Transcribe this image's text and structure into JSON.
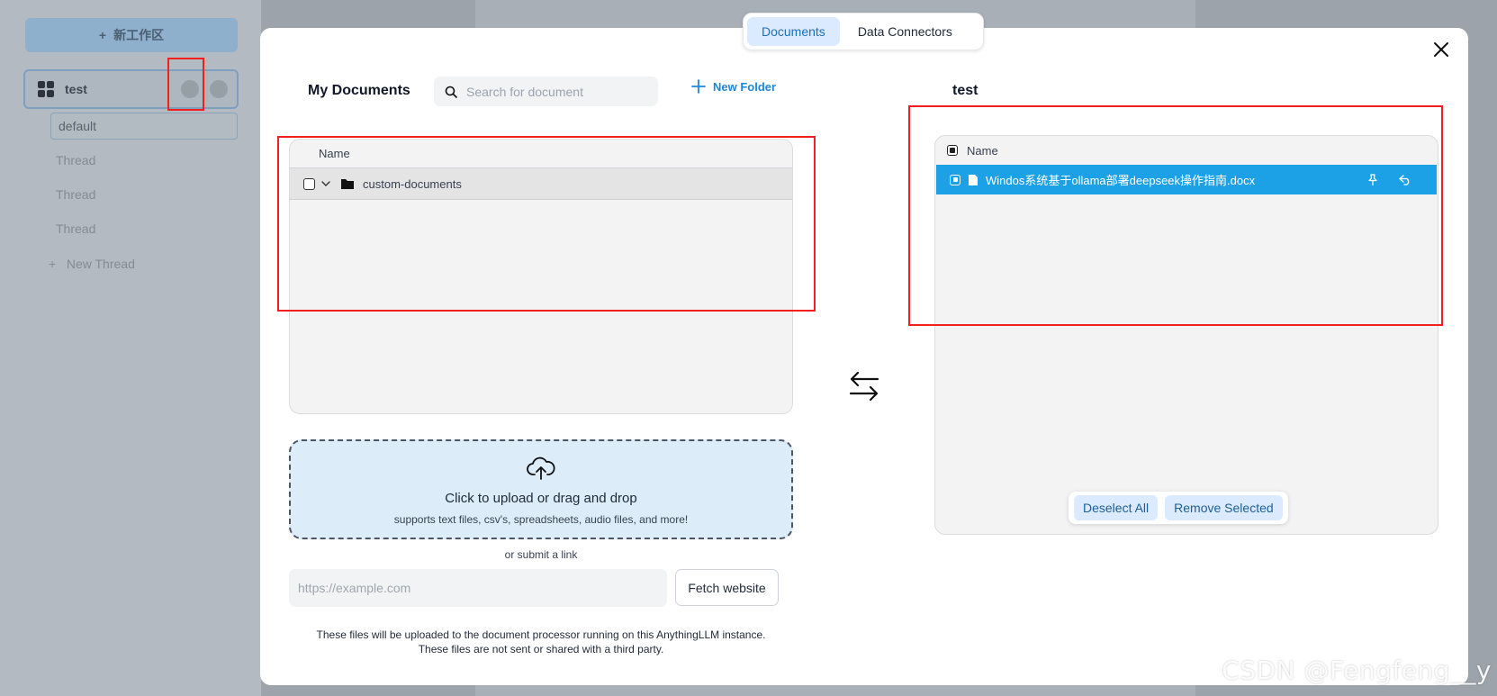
{
  "background": {
    "new_workspace_label": "新工作区",
    "workspace_name": "test",
    "threads": [
      "default",
      "Thread",
      "Thread",
      "Thread"
    ],
    "new_thread_label": "New Thread"
  },
  "modal": {
    "tabs": [
      {
        "label": "Documents",
        "active": true
      },
      {
        "label": "Data Connectors",
        "active": false
      }
    ],
    "left": {
      "title": "My Documents",
      "search_placeholder": "Search for document",
      "new_folder_label": "New Folder",
      "column_name": "Name",
      "folder_name": "custom-documents"
    },
    "upload": {
      "title": "Click to upload or drag and drop",
      "subtitle": "supports text files, csv's, spreadsheets, audio files, and more!",
      "or_link": "or submit a link",
      "url_placeholder": "https://example.com",
      "fetch_label": "Fetch website",
      "disclaimer_line1": "These files will be uploaded to the document processor running on this AnythingLLM instance.",
      "disclaimer_line2": "These files are not sent or shared with a third party."
    },
    "right": {
      "title": "test",
      "column_name": "Name",
      "file_name": "Windos系统基于ollama部署deepseek操作指南.docx",
      "deselect_label": "Deselect All",
      "remove_label": "Remove Selected"
    }
  },
  "watermark": "CSDN @Fengfeng__y",
  "colors": {
    "accent": "#1d88d8",
    "selected_row": "#1da1e6",
    "annotation_red": "#f21f1f"
  }
}
